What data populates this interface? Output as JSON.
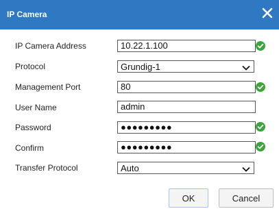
{
  "dialog": {
    "title": "IP Camera",
    "close_icon": "close-icon"
  },
  "form": {
    "ip_camera_address": {
      "label": "IP Camera Address",
      "value": "10.22.1.100",
      "valid": true
    },
    "protocol": {
      "label": "Protocol",
      "value": "Grundig-1"
    },
    "management_port": {
      "label": "Management Port",
      "value": "80",
      "valid": true
    },
    "user_name": {
      "label": "User Name",
      "value": "admin"
    },
    "password": {
      "label": "Password",
      "value": "●●●●●●●●●",
      "valid": true
    },
    "confirm": {
      "label": "Confirm",
      "value": "●●●●●●●●●",
      "valid": true
    },
    "transfer_protocol": {
      "label": "Transfer Protocol",
      "value": "Auto"
    }
  },
  "buttons": {
    "ok": "OK",
    "cancel": "Cancel"
  },
  "colors": {
    "titlebar": "#2f79c2",
    "valid_check": "#3aa53a"
  }
}
